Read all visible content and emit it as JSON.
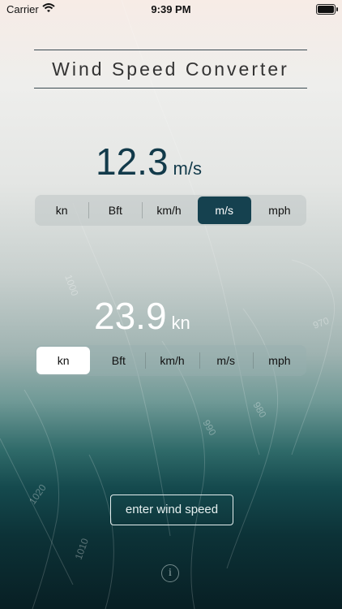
{
  "status_bar": {
    "carrier": "Carrier",
    "time": "9:39 PM",
    "wifi_icon": "wifi-icon",
    "battery_icon": "battery-icon"
  },
  "title": "Wind Speed Converter",
  "converter": {
    "input": {
      "value": "12.3",
      "unit": "m/s",
      "selected_unit": "m/s"
    },
    "output": {
      "value": "23.9",
      "unit": "kn",
      "selected_unit": "kn"
    },
    "units": [
      "kn",
      "Bft",
      "km/h",
      "m/s",
      "mph"
    ]
  },
  "background_labels": [
    "1000",
    "970",
    "990",
    "980",
    "1020",
    "1010"
  ],
  "enter_button_label": "enter wind speed",
  "info_label": "i",
  "colors": {
    "active_top": "#15414f",
    "active_bottom": "#ffffff",
    "title_text": "#333333",
    "reading_top": "#123a4a"
  }
}
